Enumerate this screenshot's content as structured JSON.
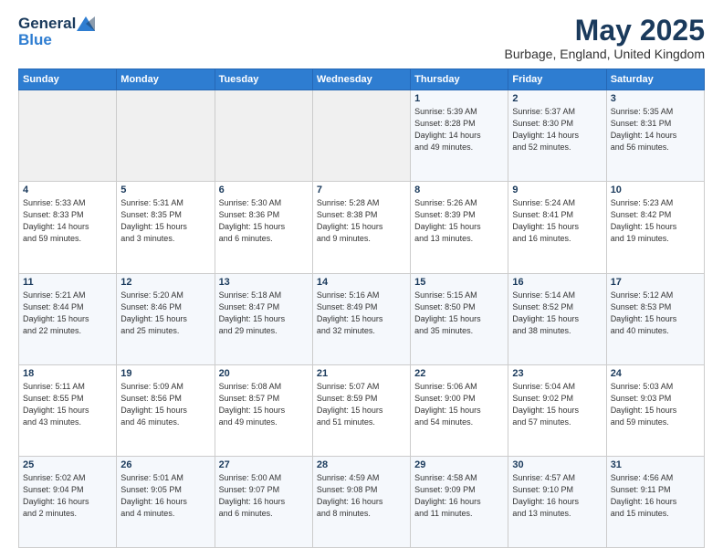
{
  "header": {
    "logo_line1": "General",
    "logo_line2": "Blue",
    "month_title": "May 2025",
    "location": "Burbage, England, United Kingdom"
  },
  "weekdays": [
    "Sunday",
    "Monday",
    "Tuesday",
    "Wednesday",
    "Thursday",
    "Friday",
    "Saturday"
  ],
  "weeks": [
    [
      {
        "day": "",
        "info": ""
      },
      {
        "day": "",
        "info": ""
      },
      {
        "day": "",
        "info": ""
      },
      {
        "day": "",
        "info": ""
      },
      {
        "day": "1",
        "info": "Sunrise: 5:39 AM\nSunset: 8:28 PM\nDaylight: 14 hours\nand 49 minutes."
      },
      {
        "day": "2",
        "info": "Sunrise: 5:37 AM\nSunset: 8:30 PM\nDaylight: 14 hours\nand 52 minutes."
      },
      {
        "day": "3",
        "info": "Sunrise: 5:35 AM\nSunset: 8:31 PM\nDaylight: 14 hours\nand 56 minutes."
      }
    ],
    [
      {
        "day": "4",
        "info": "Sunrise: 5:33 AM\nSunset: 8:33 PM\nDaylight: 14 hours\nand 59 minutes."
      },
      {
        "day": "5",
        "info": "Sunrise: 5:31 AM\nSunset: 8:35 PM\nDaylight: 15 hours\nand 3 minutes."
      },
      {
        "day": "6",
        "info": "Sunrise: 5:30 AM\nSunset: 8:36 PM\nDaylight: 15 hours\nand 6 minutes."
      },
      {
        "day": "7",
        "info": "Sunrise: 5:28 AM\nSunset: 8:38 PM\nDaylight: 15 hours\nand 9 minutes."
      },
      {
        "day": "8",
        "info": "Sunrise: 5:26 AM\nSunset: 8:39 PM\nDaylight: 15 hours\nand 13 minutes."
      },
      {
        "day": "9",
        "info": "Sunrise: 5:24 AM\nSunset: 8:41 PM\nDaylight: 15 hours\nand 16 minutes."
      },
      {
        "day": "10",
        "info": "Sunrise: 5:23 AM\nSunset: 8:42 PM\nDaylight: 15 hours\nand 19 minutes."
      }
    ],
    [
      {
        "day": "11",
        "info": "Sunrise: 5:21 AM\nSunset: 8:44 PM\nDaylight: 15 hours\nand 22 minutes."
      },
      {
        "day": "12",
        "info": "Sunrise: 5:20 AM\nSunset: 8:46 PM\nDaylight: 15 hours\nand 25 minutes."
      },
      {
        "day": "13",
        "info": "Sunrise: 5:18 AM\nSunset: 8:47 PM\nDaylight: 15 hours\nand 29 minutes."
      },
      {
        "day": "14",
        "info": "Sunrise: 5:16 AM\nSunset: 8:49 PM\nDaylight: 15 hours\nand 32 minutes."
      },
      {
        "day": "15",
        "info": "Sunrise: 5:15 AM\nSunset: 8:50 PM\nDaylight: 15 hours\nand 35 minutes."
      },
      {
        "day": "16",
        "info": "Sunrise: 5:14 AM\nSunset: 8:52 PM\nDaylight: 15 hours\nand 38 minutes."
      },
      {
        "day": "17",
        "info": "Sunrise: 5:12 AM\nSunset: 8:53 PM\nDaylight: 15 hours\nand 40 minutes."
      }
    ],
    [
      {
        "day": "18",
        "info": "Sunrise: 5:11 AM\nSunset: 8:55 PM\nDaylight: 15 hours\nand 43 minutes."
      },
      {
        "day": "19",
        "info": "Sunrise: 5:09 AM\nSunset: 8:56 PM\nDaylight: 15 hours\nand 46 minutes."
      },
      {
        "day": "20",
        "info": "Sunrise: 5:08 AM\nSunset: 8:57 PM\nDaylight: 15 hours\nand 49 minutes."
      },
      {
        "day": "21",
        "info": "Sunrise: 5:07 AM\nSunset: 8:59 PM\nDaylight: 15 hours\nand 51 minutes."
      },
      {
        "day": "22",
        "info": "Sunrise: 5:06 AM\nSunset: 9:00 PM\nDaylight: 15 hours\nand 54 minutes."
      },
      {
        "day": "23",
        "info": "Sunrise: 5:04 AM\nSunset: 9:02 PM\nDaylight: 15 hours\nand 57 minutes."
      },
      {
        "day": "24",
        "info": "Sunrise: 5:03 AM\nSunset: 9:03 PM\nDaylight: 15 hours\nand 59 minutes."
      }
    ],
    [
      {
        "day": "25",
        "info": "Sunrise: 5:02 AM\nSunset: 9:04 PM\nDaylight: 16 hours\nand 2 minutes."
      },
      {
        "day": "26",
        "info": "Sunrise: 5:01 AM\nSunset: 9:05 PM\nDaylight: 16 hours\nand 4 minutes."
      },
      {
        "day": "27",
        "info": "Sunrise: 5:00 AM\nSunset: 9:07 PM\nDaylight: 16 hours\nand 6 minutes."
      },
      {
        "day": "28",
        "info": "Sunrise: 4:59 AM\nSunset: 9:08 PM\nDaylight: 16 hours\nand 8 minutes."
      },
      {
        "day": "29",
        "info": "Sunrise: 4:58 AM\nSunset: 9:09 PM\nDaylight: 16 hours\nand 11 minutes."
      },
      {
        "day": "30",
        "info": "Sunrise: 4:57 AM\nSunset: 9:10 PM\nDaylight: 16 hours\nand 13 minutes."
      },
      {
        "day": "31",
        "info": "Sunrise: 4:56 AM\nSunset: 9:11 PM\nDaylight: 16 hours\nand 15 minutes."
      }
    ]
  ]
}
